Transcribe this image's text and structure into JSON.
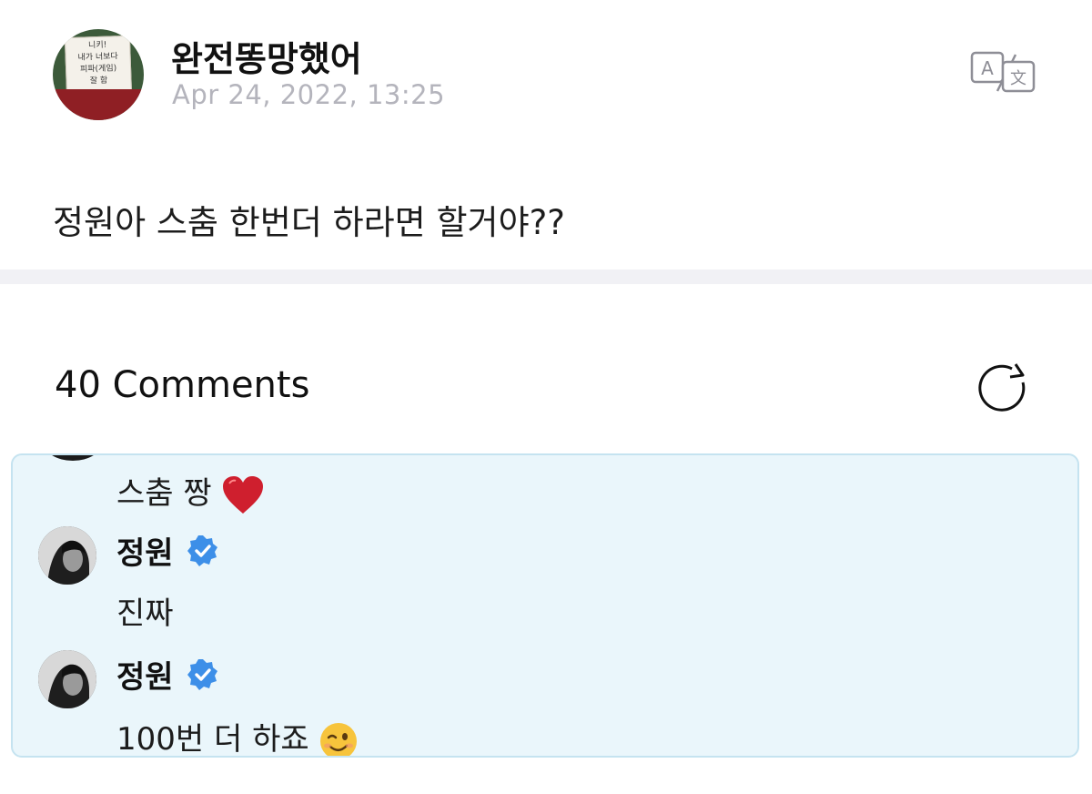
{
  "post": {
    "avatar_note": [
      "니키!",
      "내가 너보다",
      "피파(게임)",
      "잘 함"
    ],
    "author": "완전똥망했어",
    "timestamp": "Apr 24, 2022, 13:25",
    "body": "정원아 스춤 한번더 하라면 할거야??",
    "translate_icon": "translate-icon"
  },
  "comments": {
    "title": "40 Comments",
    "refresh_icon": "refresh-icon",
    "replies": [
      {
        "text": "스춤 짱",
        "emoji": "red-heart"
      },
      {
        "author": "정원",
        "verified": true,
        "text": "진짜"
      },
      {
        "author": "정원",
        "verified": true,
        "text": "100번 더 하죠",
        "emoji": "winking-face"
      }
    ]
  },
  "colors": {
    "reply_bg": "#eaf6fb",
    "reply_border": "#c5e3f0",
    "verified_blue": "#3d8fe8",
    "muted": "#b4b4bc",
    "divider": "#f1f1f5"
  }
}
